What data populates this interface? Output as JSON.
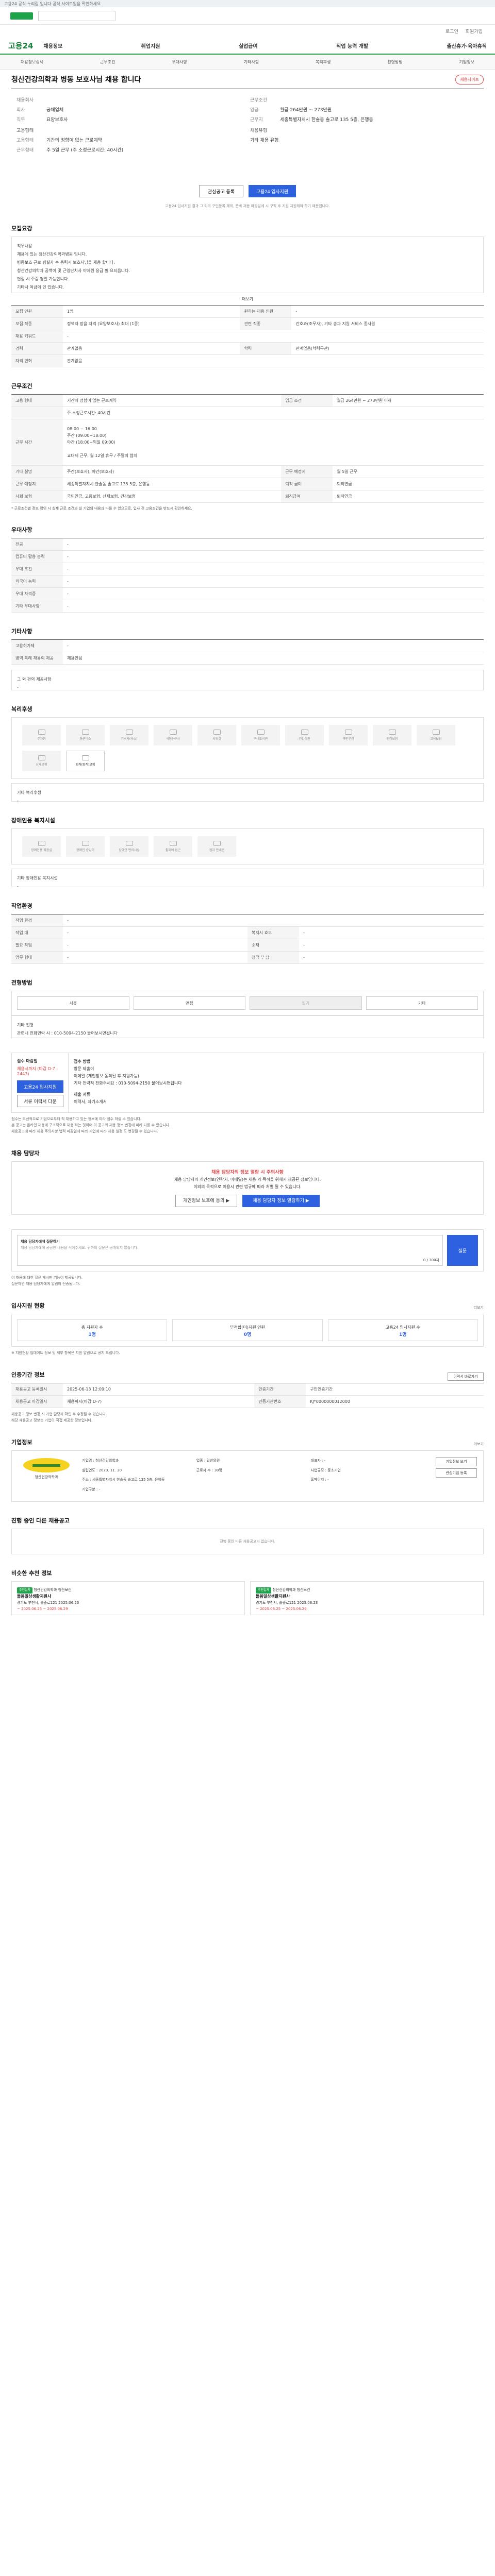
{
  "top": {
    "notice": "고용24 공식 누리집 입니다 공식 사이트임을 확인하세요",
    "login": "로그인",
    "join": "회원가입"
  },
  "gnb": {
    "brand": "고용24",
    "menu": [
      "채용정보",
      "취업지원",
      "실업급여",
      "직업 능력 개발",
      "출산휴가·육아휴직"
    ],
    "sub": [
      "채용정보검색",
      "근무조건",
      "우대사항",
      "기타사항",
      "복리후생",
      "전형방법",
      "기업정보"
    ]
  },
  "job": {
    "title": "청산건강의학과 병동 보호사님 채용 합니다",
    "apply_sub_btn": "채용사이트"
  },
  "summary": {
    "left": [
      {
        "k": "채용회사",
        "v": ""
      },
      {
        "k": "회사",
        "v": "공채업체"
      },
      {
        "k": "직무",
        "v": "요양보호사"
      }
    ],
    "right": [
      {
        "k": "근무조건",
        "v": ""
      },
      {
        "k": "임금",
        "v": "월급 264만원 ~ 273만원"
      },
      {
        "k": "근무지",
        "v": "세종특별자치시 한솔동 솔고로 135 5층, 은행동"
      }
    ],
    "req_title": "고용형태",
    "req": [
      {
        "k": "고용형태",
        "v": "기간의 정함이 없는 근로계약"
      },
      {
        "k": "근무형태",
        "v": "주 5일 근무 (주 소정근로시간: 40시간)"
      }
    ],
    "cert_title": "채용유형",
    "cert_v": "기타 채용 유형"
  },
  "apply": {
    "scrap": "관심공고 등록",
    "apply": "고용24 입사지원",
    "notice": "고용24 입사지원 결과 그 외의 구인등록 제외, 준비 채용 마감일에 시 구직 후 지원 지원해야 하기 때문입니다."
  },
  "recruit": {
    "title": "모집요강",
    "desc": "직무내용\n채용에 있는 청산건강의학과병원 입니다.\n병동보호 근로 병설자 수 용력시 보호자님을 채용 합니다.\n청산건강의학과 공백이 및 근영단치사 야자원 응급 필 요되읍니다.\n면접 시 주중 평일 가능합니다.\n기타사 여급에 인 있습니다.",
    "more": "더보기",
    "rows": [
      [
        "모집 인원",
        "1명",
        "원하는 채용 인원",
        "-"
      ],
      [
        "모집 직종",
        "정책자 장을 자격 (요양보호사) 최대 (1종)",
        "관련 직종",
        "간호과(조무사), 기타 송과 지원 서비스 종사원"
      ],
      [
        "채용 키워드",
        "-",
        "",
        ""
      ],
      [
        "경력",
        "관계없음",
        "학력",
        "관계없음(학력무관)"
      ],
      [
        "자격 면허",
        "관계없음",
        "",
        ""
      ]
    ]
  },
  "work": {
    "title": "근무조건",
    "rows": [
      [
        "고용 형태",
        "기간의 정함이 없는 근로계약",
        "임금 조건",
        "월급 264만원 ~ 273만원 이하"
      ],
      [
        "",
        "주 소정근로시간: 40시간",
        "",
        ""
      ],
      [
        "근무 시간",
        "",
        "",
        ""
      ],
      [
        "근무 예정지",
        "세종특별자치시 한솔동 솔고로 135 5층, 은행동",
        "",
        ""
      ],
      [
        "퇴직 급여",
        "퇴직연금",
        "",
        ""
      ],
      [
        "근무 요일",
        "",
        "주 5일 근무",
        ""
      ]
    ],
    "time_detail": "08:00 ~ 16:00\n주간 (09:00~18:00)\n야간 (18:00~익일 09:00)\n\n교대제 근무, 월 12일 휴무 / 주말의 협의",
    "extra": [
      "기타 설명",
      "주간(보호사), 야간(보호사)",
      "근무 예정지",
      "월 5일 근무"
    ],
    "ins": [
      "사회 보험",
      "국민연금, 고용보험, 산재보험, 건강보험",
      "퇴직급여",
      "퇴직연금"
    ],
    "note": "* 근로조건별 정보 확인 시 실제 근로 조건과 실 기업의 내용과 다를 수 있으므로, 입사 전 고용조건을 반드시 확인하세요."
  },
  "pref": {
    "title": "우대사항",
    "rows": [
      [
        "전공",
        "-"
      ],
      [
        "컴퓨터 활용 능력",
        "-"
      ],
      [
        "우대 조건",
        "-"
      ],
      [
        "외국어 능력",
        "-"
      ],
      [
        "우대 자격증",
        "-"
      ],
      [
        "기타 우대사항",
        "-"
      ]
    ]
  },
  "etc": {
    "title": "기타사항",
    "rows": [
      [
        "고용허가제",
        "-"
      ],
      [
        "병역 특례 채용의 제공",
        "채용안됨"
      ]
    ],
    "extra": "그 외 편의 제공사항",
    "extra_v": "-"
  },
  "welfare": {
    "title": "복리후생",
    "icons": [
      "주차장",
      "통근버스",
      "기숙사(숙소)",
      "식당(식사)",
      "샤워실",
      "구내도서관",
      "건강검진",
      "국민연금",
      "건강보험",
      "고용보험",
      "산재보험",
      "퇴직(퇴직)보험"
    ],
    "other_label": "기타 복리후생",
    "other_v": "-"
  },
  "disabled": {
    "title": "장애인용 복지시설",
    "icons": [
      "장애인용 화장실",
      "장애인 승강기",
      "장애인 편의시설",
      "휠체어 접근",
      "점자 안내판"
    ],
    "other_label": "기타 장애인용 복지시설",
    "other_v": "-"
  },
  "workenv": {
    "title": "작업환경",
    "rows": [
      [
        "작업 환경",
        "-",
        "",
        ""
      ],
      [
        "작업 대",
        "-",
        "복지시 효도",
        "-"
      ],
      [
        "필요 작업",
        "-",
        "소재",
        "-"
      ],
      [
        "업무 형태",
        "-",
        "청각 부 담",
        "-"
      ]
    ]
  },
  "process": {
    "title": "전형방법",
    "methods": [
      "서류",
      "면접",
      "필기",
      "기타"
    ],
    "detail_label": "기타 전형",
    "detail_v": "관련내 전화연락 시 : 010-5094-2150 물어보시면됩니다"
  },
  "apply_info": {
    "left_title": "접수 마감일",
    "left_v": "채용시까지 (마감 D-7 : 2443)",
    "right_title": "접수 방법",
    "right_v": "방문 제출이\n이메일 (개인정보 동의된 후 지원가능)\n기타 전략적 전화주세요 : 010-5094-2150 물어보시면됩니다",
    "btn1": "고용24 입사지원",
    "btn2": "서류 이력서 다운",
    "req_title": "제출 서류",
    "req_v": "이력서, 자기소개서",
    "bullets": [
      "접수는 우선적으로 기업으로부터 직 채용하고 있는 정보에 따라 접수 하실 수 있습니다.",
      "본 공고는 온라인 채용에 구조적으로 채용 하는 것이며 이 공고의 채용 정보 변경에 따라 다를 수 있습니다.",
      "채용공고에 따라 채용 주의사항 법적 마감일에 따라 기업에 따라 채용 일정 도 변경될 수 있습니다."
    ]
  },
  "manager": {
    "title": "채용 담당자",
    "alert": "채용 담당자의 정보 열람 시 주의사항",
    "line1": "채용 담당자의 개인정보(연락처, 이메일)는 채용 외 목적을 위해서 제공된 정보입니다.",
    "line2": "이외의 목적으로 이용시 관련 법규에 따라 처벌 될 수 있습니다.",
    "b1": "개인정보 보호에 동의 ▶",
    "b2": "채용 담당자 정보 열람하기 ▶"
  },
  "qna": {
    "title": "채용 담당자에게 질문하기",
    "placeholder": "채용 담당자에게 궁금한 내용을 적어주세요. 귀하의 질문은 공개되지 않습니다.",
    "count": "0 / 300자",
    "submit": "질문",
    "bullets": [
      "이 채용에 대한 질문 게시판 기능이 제공됩니다.",
      "질문하면 채용 담당자에게 알림이 전송됩니다."
    ]
  },
  "stats": {
    "title": "입사지원 현황",
    "more": "더보기",
    "items": [
      {
        "l": "총 지원자 수",
        "n": "1명"
      },
      {
        "l": "부적합(미)지원 인원",
        "n": "0명"
      },
      {
        "l": "고용24 입사지원 수",
        "n": "1명"
      }
    ],
    "note": "※ 지원현황 업데이트 정보 및 세부 항목은 지원 알림으로 공지 드립니다."
  },
  "period": {
    "title": "인증기간 정보",
    "rows": [
      [
        "채용공고 등록일시",
        "2025-06-13 12:09:10",
        "인증기간",
        "구인인증기간"
      ],
      [
        "채용공고 마감일시",
        "채용까지(마감 D-7)",
        "인증기관번호",
        "KJ*0000000012000"
      ]
    ],
    "btn": "이력서 바로가기",
    "notes": [
      "채용공고 정보 변경 시 기업 담당자 확인 후 수정될 수 있습니다.",
      "해당 채용공고 정보는 기업이 직접 제공한 정보입니다."
    ]
  },
  "company": {
    "title": "기업정보",
    "more": "더보기",
    "name": "청산건강의학과",
    "fields": [
      [
        "기업명",
        "청산건강의학과"
      ],
      [
        "업종",
        "일반의원"
      ],
      [
        "대표자",
        "-"
      ],
      [
        "설립연도",
        "2023. 11. 20"
      ],
      [
        "근로자 수",
        "30명"
      ],
      [
        "사업규모",
        "중소기업"
      ],
      [
        "주소",
        "세종특별자치시 한솔동 솔고로 135 5층, 은행동"
      ],
      [
        "홈페이지",
        "-"
      ],
      [
        "기업구분",
        "-"
      ]
    ],
    "b1": "기업정보 보기",
    "b2": "관심기업 등록"
  },
  "other": {
    "title": "진행 중인 다른 채용공고",
    "empty": "진행 중인 다른 채용공고가 없습니다."
  },
  "recent": {
    "title": "비슷한 추천 정보",
    "cards": [
      {
        "tag": "추천일자",
        "co": "청산건강의학과 청산보건",
        "title": "돌봄일상생활지원사",
        "meta": "경기도 부천시, 솔숲로121 2025.06.23",
        "date": "~ 2025.06.25 ~ 2025.06.29"
      },
      {
        "tag": "추천일자",
        "co": "청산건강의학과 청산보건",
        "title": "돌봄일상생활지원사",
        "meta": "경기도 부천시, 솔숲로121 2025.06.23",
        "date": "~ 2025.06.25 ~ 2025.06.29"
      }
    ]
  }
}
